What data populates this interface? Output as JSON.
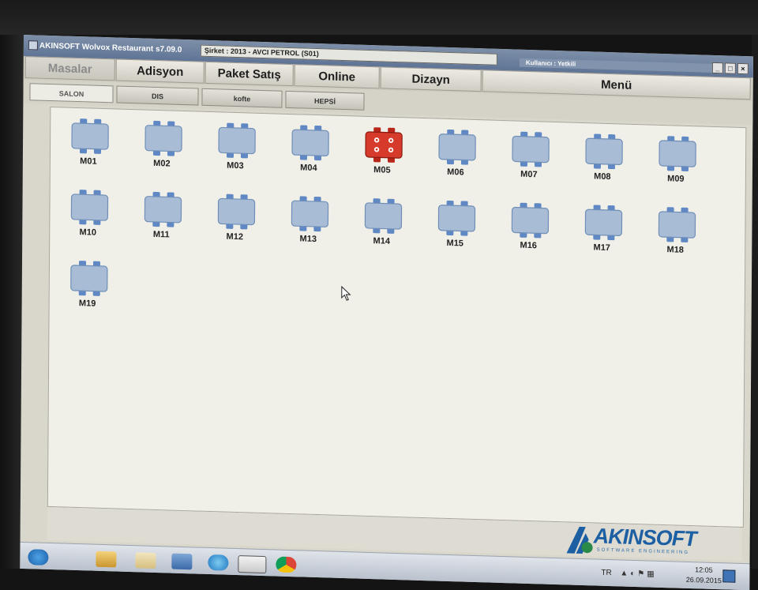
{
  "window": {
    "title": "AKINSOFT Wolvox Restaurant s7.09.0",
    "company": "Şirket : 2013 - AVCI PETROL (S01)",
    "user": "Kullanıcı : Yetkili"
  },
  "menu_tabs": [
    {
      "label": "Masalar",
      "active": true
    },
    {
      "label": "Adisyon",
      "active": false
    },
    {
      "label": "Paket Satış",
      "active": false
    },
    {
      "label": "Online",
      "active": false
    },
    {
      "label": "Dizayn",
      "active": false
    },
    {
      "label": "Menü",
      "active": false
    }
  ],
  "section_tabs": [
    {
      "label": "SALON",
      "active": true
    },
    {
      "label": "DIS",
      "active": false
    },
    {
      "label": "kofte",
      "active": false
    },
    {
      "label": "HEPSİ",
      "active": false
    }
  ],
  "tables": [
    {
      "label": "M01",
      "status": "empty"
    },
    {
      "label": "M02",
      "status": "empty"
    },
    {
      "label": "M03",
      "status": "empty"
    },
    {
      "label": "M04",
      "status": "empty"
    },
    {
      "label": "M05",
      "status": "occupied"
    },
    {
      "label": "M06",
      "status": "empty"
    },
    {
      "label": "M07",
      "status": "empty"
    },
    {
      "label": "M08",
      "status": "empty"
    },
    {
      "label": "M09",
      "status": "empty"
    },
    {
      "label": "M10",
      "status": "empty"
    },
    {
      "label": "M11",
      "status": "empty"
    },
    {
      "label": "M12",
      "status": "empty"
    },
    {
      "label": "M13",
      "status": "empty"
    },
    {
      "label": "M14",
      "status": "empty"
    },
    {
      "label": "M15",
      "status": "empty"
    },
    {
      "label": "M16",
      "status": "empty"
    },
    {
      "label": "M17",
      "status": "empty"
    },
    {
      "label": "M18",
      "status": "empty"
    },
    {
      "label": "M19",
      "status": "empty"
    }
  ],
  "colors": {
    "empty_table": "#a9bcd6",
    "empty_chair": "#5f88c4",
    "occupied_table": "#d63a2a",
    "brand": "#1d5fa3"
  },
  "logo": {
    "name": "AKINSOFT",
    "tagline": "SOFTWARE ENGINEERING"
  },
  "taskbar": {
    "apps": [
      "start-orb-icon",
      "explorer-icon",
      "folder-icon",
      "network-icon",
      "ie-icon",
      "restaurant-app-icon",
      "chrome-icon"
    ],
    "language": "TR",
    "time": "12:05",
    "date": "26.09.2015"
  }
}
